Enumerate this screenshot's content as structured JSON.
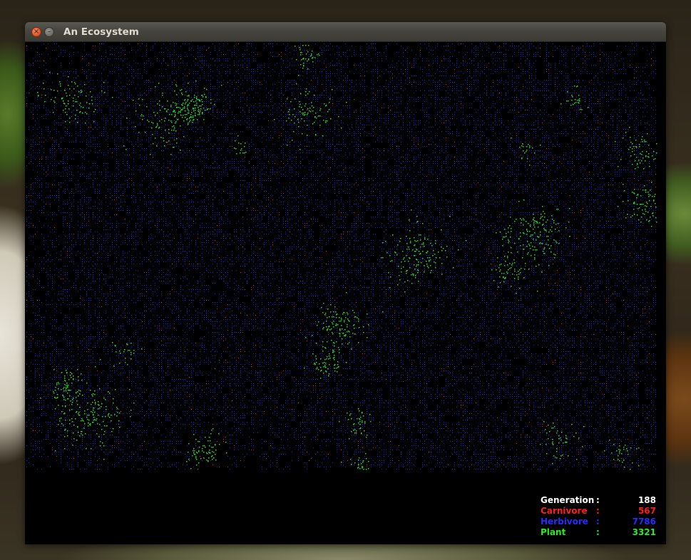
{
  "window": {
    "title": "An Ecosystem",
    "close_glyph": "×",
    "minimize_glyph": "–"
  },
  "stats": {
    "generation": {
      "label": "Generation",
      "sep": ":",
      "value": "188"
    },
    "carnivore": {
      "label": "Carnivore",
      "sep": ":",
      "value": "567"
    },
    "herbivore": {
      "label": "Herbivore",
      "sep": ":",
      "value": "7786"
    },
    "plant": {
      "label": "Plant",
      "sep": ":",
      "value": "3321"
    }
  },
  "colors": {
    "carnivore": "#ff2020",
    "herbivore": "#2020ff",
    "plant": "#20e020",
    "background": "#000000"
  }
}
